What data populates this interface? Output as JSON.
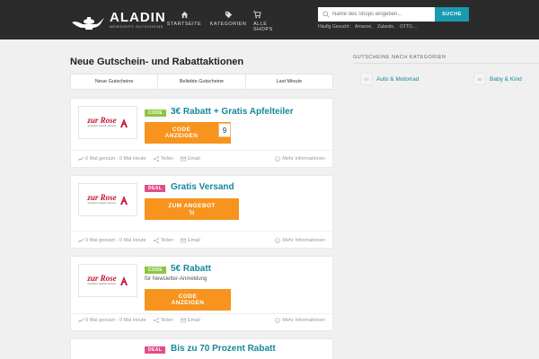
{
  "header": {
    "logo_name": "ALADIN",
    "logo_sub": "WEBSHOPS GUTSCHEINE",
    "nav": [
      {
        "label": "STARTSEITE",
        "icon": "home-icon"
      },
      {
        "label": "KATEGORIEN",
        "icon": "tags-icon"
      },
      {
        "label_line1": "ALLE",
        "label_line2": "SHOPS",
        "icon": "cart-icon"
      }
    ],
    "search_placeholder": "Name des Shops eingeben...",
    "search_button": "SUCHE",
    "popular_label": "Häufig Gesucht:",
    "popular_items": [
      "Amazon,",
      "Zalando,",
      "OTTO,..."
    ]
  },
  "main": {
    "title": "Neue Gutschein- und Rabattaktionen",
    "tabs": [
      "Neue Gutscheine",
      "Beliebte Gutscheine",
      "Last Minute"
    ],
    "shop_logo": {
      "name": "zur Rose",
      "tagline": "Geschützt. Geprüft. Gesund."
    },
    "cards": [
      {
        "type": "CODE",
        "title": "3€ Rabatt + Gratis Apfelteiler",
        "subtitle": "",
        "button_line1": "CODE",
        "button_line2": "ANZEIGEN",
        "peel_char": "9",
        "used": "0 Mal genutzt - 0 Mal Heute",
        "share": "Teilen",
        "email": "Email",
        "more": "Mehr Informationen"
      },
      {
        "type": "DEAL",
        "title": "Gratis Versand",
        "subtitle": "",
        "button_line1": "ZUM ANGEBOT",
        "used": "0 Mal genutzt - 0 Mal Heute",
        "share": "Teilen",
        "email": "Email",
        "more": "Mehr Informationen"
      },
      {
        "type": "CODE",
        "title": "5€ Rabatt",
        "subtitle": "für Newsletter-Anmeldung",
        "button_line1": "CODE",
        "button_line2": "ANZEIGEN",
        "used": "0 Mal genutzt - 0 Mal Heute",
        "share": "Teilen",
        "email": "Email",
        "more": "Mehr Informationen"
      },
      {
        "type": "DEAL",
        "title": "Bis zu 70 Prozent Rabatt"
      }
    ]
  },
  "sidebar": {
    "title": "GUTSCHEINE NACH KATEGORIEN",
    "categories": [
      {
        "count": "97",
        "label": "Auto & Motorrad"
      },
      {
        "count": "80",
        "label": "Baby & Kind"
      }
    ]
  },
  "colors": {
    "header_bg": "#2b2b2b",
    "accent_teal": "#16889c",
    "button_orange": "#f7941e",
    "code_badge": "#8cc63f",
    "deal_badge": "#e04e8a"
  }
}
